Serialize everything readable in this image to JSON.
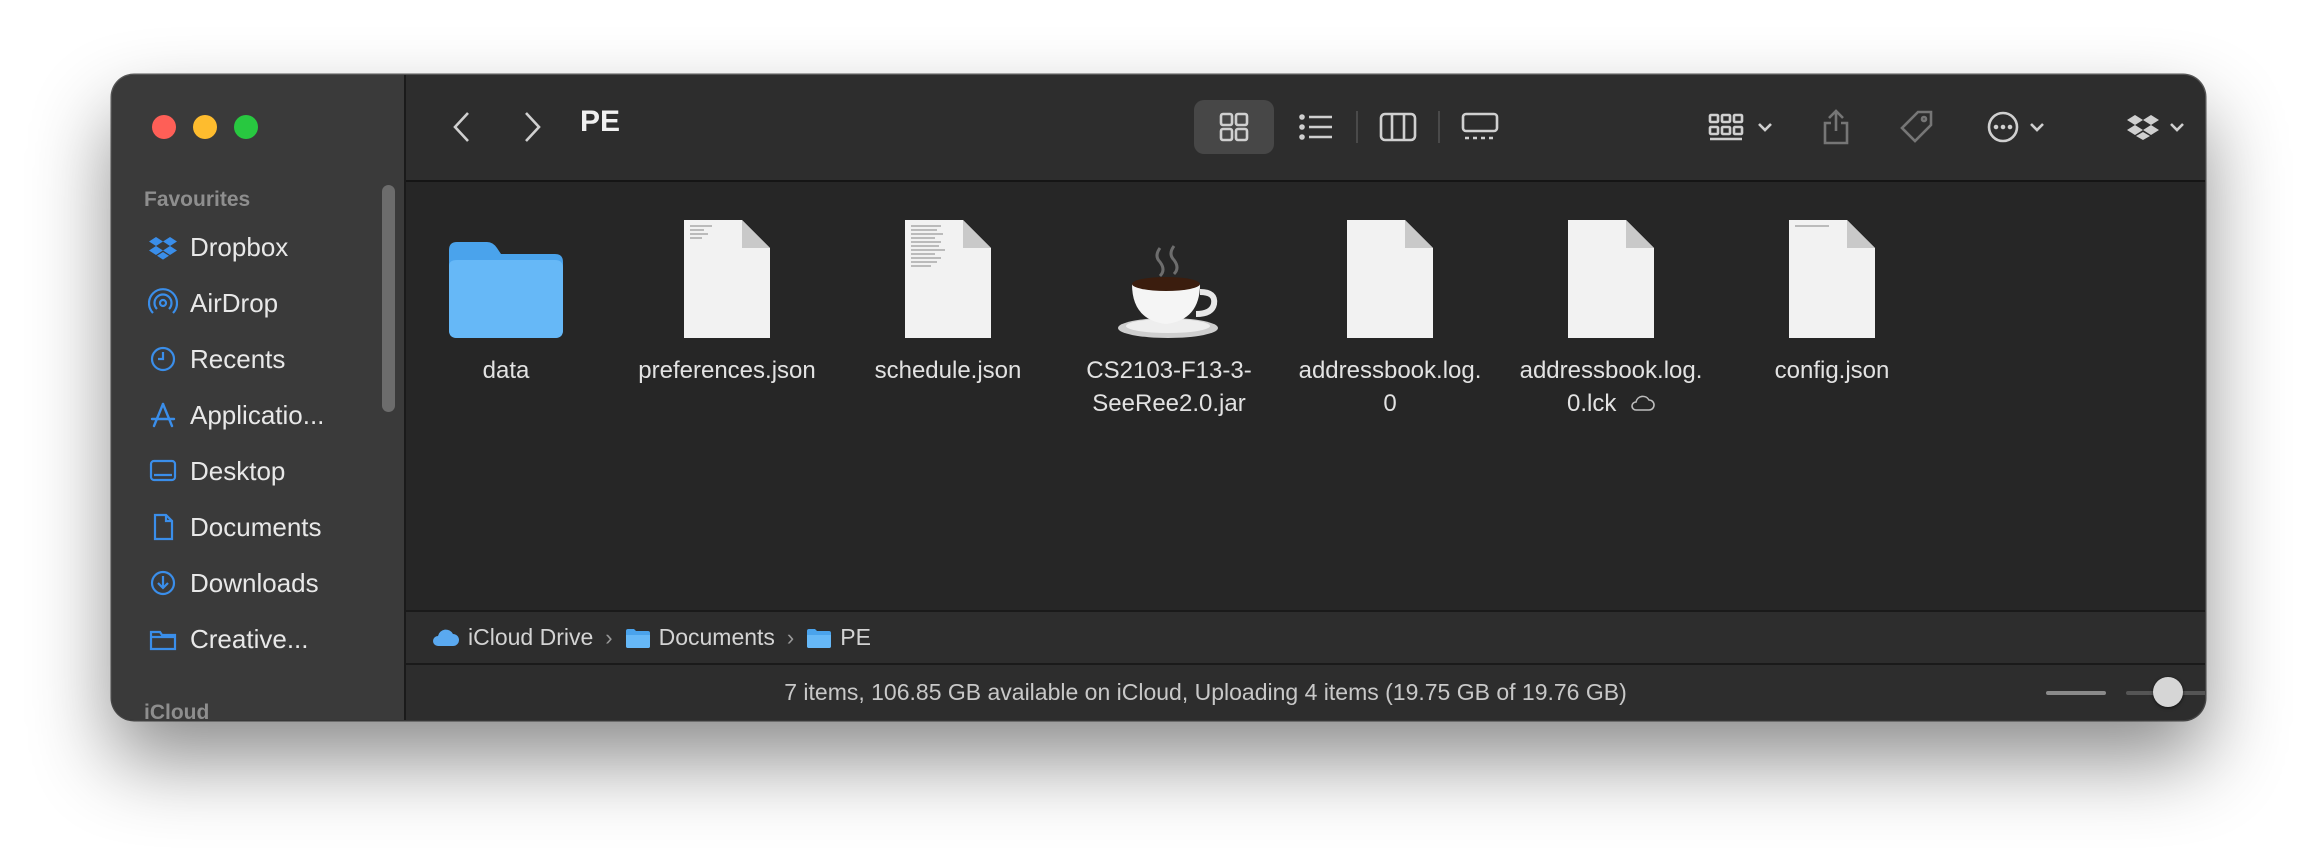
{
  "window": {
    "title": "PE"
  },
  "sidebar": {
    "sections": [
      {
        "label": "Favourites"
      },
      {
        "label": "iCloud"
      }
    ],
    "items": [
      {
        "label": "Dropbox",
        "icon": "dropbox-icon"
      },
      {
        "label": "AirDrop",
        "icon": "airdrop-icon"
      },
      {
        "label": "Recents",
        "icon": "clock-icon"
      },
      {
        "label": "Applicatio...",
        "icon": "applications-icon"
      },
      {
        "label": "Desktop",
        "icon": "desktop-icon"
      },
      {
        "label": "Documents",
        "icon": "document-icon"
      },
      {
        "label": "Downloads",
        "icon": "download-icon"
      },
      {
        "label": "Creative...",
        "icon": "folder-icon"
      }
    ]
  },
  "files": [
    {
      "line1": "data",
      "line2": "",
      "icon": "folder-icon"
    },
    {
      "line1": "preferences.json",
      "line2": "",
      "icon": "file-icon"
    },
    {
      "line1": "schedule.json",
      "line2": "",
      "icon": "file-icon"
    },
    {
      "line1": "CS2103-F13-3-",
      "line2": "SeeRee2.0.jar",
      "icon": "java-coffee-icon"
    },
    {
      "line1": "addressbook.log.",
      "line2": "0",
      "icon": "file-icon"
    },
    {
      "line1": "addressbook.log.",
      "line2": "0.lck",
      "icon": "file-icon",
      "cloud": "cloud-icon"
    },
    {
      "line1": "config.json",
      "line2": "",
      "icon": "file-icon"
    }
  ],
  "pathbar": {
    "crumbs": [
      {
        "label": "iCloud Drive",
        "icon": "icloud-icon"
      },
      {
        "label": "Documents",
        "icon": "folder-icon"
      },
      {
        "label": "PE",
        "icon": "folder-icon"
      }
    ],
    "separator": "›"
  },
  "status": {
    "text": "7 items, 106.85 GB available on iCloud, Uploading 4 items (19.75 GB of 19.76 GB)",
    "icon_size_level": 0.2
  },
  "colors": {
    "accent": "#3a8eea",
    "folder": "#62b5f5",
    "close": "#fe5f57",
    "minimize": "#febc2e",
    "zoom": "#28c840"
  }
}
